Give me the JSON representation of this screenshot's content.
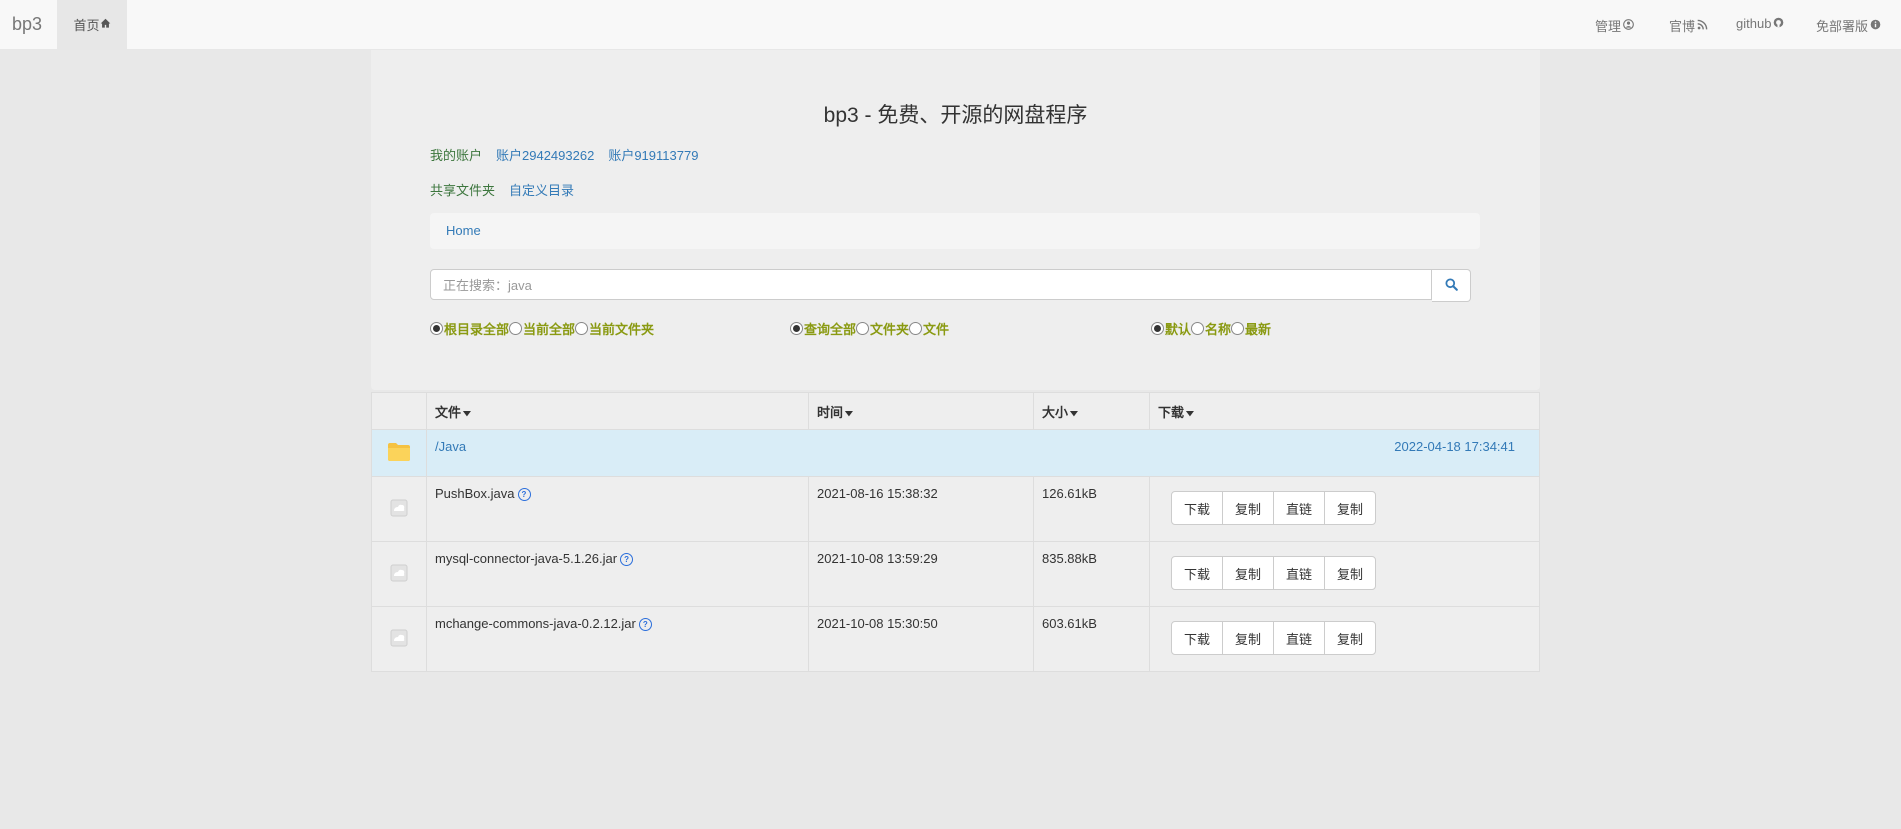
{
  "nav": {
    "brand": "bp3",
    "home": "首页",
    "admin": "管理",
    "blog": "官博",
    "github": "github",
    "disclaimer": "免部署版"
  },
  "header": {
    "title": "bp3 - 免费、开源的网盘程序"
  },
  "accounts": {
    "mine": "我的账户",
    "acct1": "账户2942493262",
    "acct2": "账户919113779"
  },
  "folders": {
    "shared": "共享文件夹",
    "custom": "自定义目录"
  },
  "breadcrumb": {
    "home": "Home"
  },
  "search": {
    "placeholder": "正在搜索：java"
  },
  "scope": {
    "root_all": "根目录全部",
    "current_all": "当前全部",
    "current_folder": "当前文件夹"
  },
  "query": {
    "all": "查询全部",
    "folders": "文件夹",
    "files": "文件"
  },
  "sort": {
    "default": "默认",
    "name": "名称",
    "latest": "最新"
  },
  "table": {
    "headers": {
      "file": "文件",
      "time": "时间",
      "size": "大小",
      "download": "下载"
    },
    "folder": {
      "name": "/Java",
      "time": "2022-04-18 17:34:41"
    },
    "rows": [
      {
        "name": "PushBox.java",
        "time": "2021-08-16 15:38:32",
        "size": "126.61kB"
      },
      {
        "name": "mysql-connector-java-5.1.26.jar",
        "time": "2021-10-08 13:59:29",
        "size": "835.88kB"
      },
      {
        "name": "mchange-commons-java-0.2.12.jar",
        "time": "2021-10-08 15:30:50",
        "size": "603.61kB"
      }
    ],
    "actions": {
      "download": "下载",
      "copy": "复制",
      "direct": "直链",
      "copy2": "复制"
    }
  },
  "colors": {
    "accent": "#337ab7",
    "green": "#3c763d",
    "radio_label": "#8a9a12",
    "folder_row": "#d9edf7",
    "folder_icon": "#f5c242"
  },
  "icons": {
    "home": "home-icon",
    "admin": "user-circle-icon",
    "blog": "rss-icon",
    "github": "github-icon",
    "disclaimer": "info-circle-icon",
    "search": "search-icon",
    "folder": "folder-icon",
    "file": "file-icon",
    "help": "question-circle-icon",
    "chevron": "chevron-down-icon"
  }
}
